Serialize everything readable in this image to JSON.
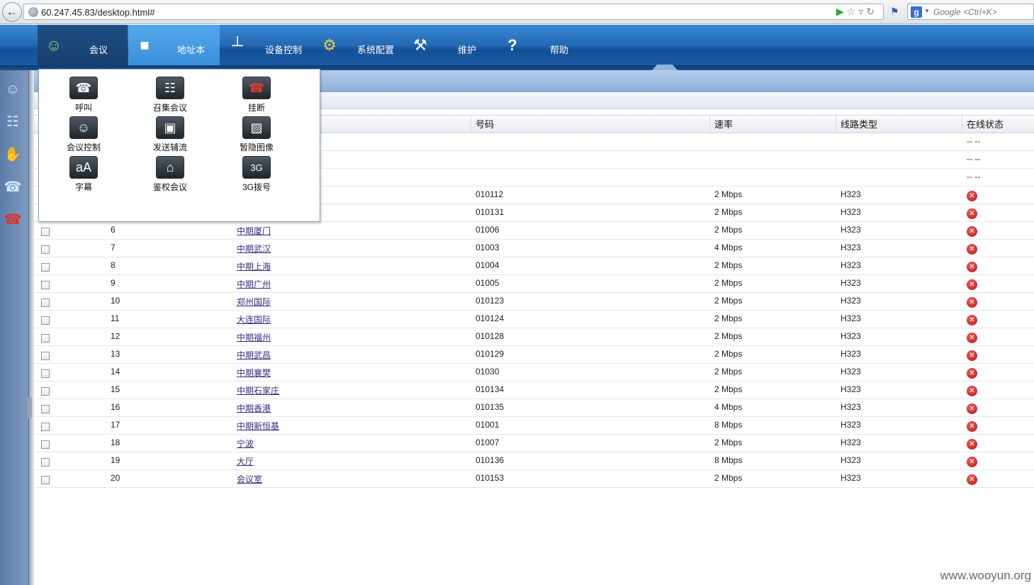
{
  "browser": {
    "back_icon": "arrow-left-icon",
    "url": "60.247.45.83/desktop.html#",
    "search_placeholder": "Google <Ctrl+K>"
  },
  "nav": {
    "tabs": [
      {
        "label": "会议",
        "icon": "people-icon"
      },
      {
        "label": "地址本",
        "icon": "address-book-icon"
      },
      {
        "label": "设备控制",
        "icon": "joystick-icon"
      },
      {
        "label": "系统配置",
        "icon": "gear-icon"
      },
      {
        "label": "维护",
        "icon": "tools-icon"
      },
      {
        "label": "帮助",
        "icon": "question-icon"
      }
    ]
  },
  "sidebar": {
    "items": [
      "meeting-icon",
      "conference-icon",
      "hand-icon",
      "phone-call-icon",
      "hangup-icon"
    ]
  },
  "dropdown": {
    "items": [
      {
        "label": "呼叫",
        "icon": "phone-call-icon"
      },
      {
        "label": "召集会议",
        "icon": "convene-icon"
      },
      {
        "label": "挂断",
        "icon": "hangup-icon"
      },
      {
        "label": "会议控制",
        "icon": "meeting-control-icon"
      },
      {
        "label": "发送辅流",
        "icon": "monitor-icon"
      },
      {
        "label": "暂隐图像",
        "icon": "hide-image-icon"
      },
      {
        "label": "字幕",
        "icon": "caption-icon"
      },
      {
        "label": "鉴权会议",
        "icon": "lock-icon"
      },
      {
        "label": "3G拨号",
        "icon": "3g-dial-icon"
      }
    ]
  },
  "table": {
    "headers": {
      "number": "号码",
      "rate": "速率",
      "line": "线路类型",
      "status": "在线状态"
    },
    "placeholder_status": "-- --",
    "rows": [
      {
        "idx": "",
        "name": "",
        "number": "",
        "rate": "",
        "line": "",
        "status": "placeholder"
      },
      {
        "idx": "",
        "name": "",
        "number": "",
        "rate": "",
        "line": "",
        "status": "placeholder"
      },
      {
        "idx": "",
        "name": "",
        "number": "",
        "rate": "",
        "line": "",
        "status": "placeholder"
      },
      {
        "idx": "",
        "name": "",
        "number": "010112",
        "rate": "2 Mbps",
        "line": "H323",
        "status": "offline"
      },
      {
        "idx": "",
        "name": "",
        "number": "010131",
        "rate": "2 Mbps",
        "line": "H323",
        "status": "offline"
      },
      {
        "idx": "6",
        "name": "中期厦门",
        "number": "01006",
        "rate": "2 Mbps",
        "line": "H323",
        "status": "offline"
      },
      {
        "idx": "7",
        "name": "中期武汉",
        "number": "01003",
        "rate": "4 Mbps",
        "line": "H323",
        "status": "offline"
      },
      {
        "idx": "8",
        "name": "中期上海",
        "number": "01004",
        "rate": "2 Mbps",
        "line": "H323",
        "status": "offline"
      },
      {
        "idx": "9",
        "name": "中期广州",
        "number": "01005",
        "rate": "2 Mbps",
        "line": "H323",
        "status": "offline"
      },
      {
        "idx": "10",
        "name": "郑州国际",
        "number": "010123",
        "rate": "2 Mbps",
        "line": "H323",
        "status": "offline"
      },
      {
        "idx": "11",
        "name": "大连国际",
        "number": "010124",
        "rate": "2 Mbps",
        "line": "H323",
        "status": "offline"
      },
      {
        "idx": "12",
        "name": "中期福州",
        "number": "010128",
        "rate": "2 Mbps",
        "line": "H323",
        "status": "offline"
      },
      {
        "idx": "13",
        "name": "中期武昌",
        "number": "010129",
        "rate": "2 Mbps",
        "line": "H323",
        "status": "offline"
      },
      {
        "idx": "14",
        "name": "中期襄樊",
        "number": "01030",
        "rate": "2 Mbps",
        "line": "H323",
        "status": "offline"
      },
      {
        "idx": "15",
        "name": "中期石家庄",
        "number": "010134",
        "rate": "2 Mbps",
        "line": "H323",
        "status": "offline"
      },
      {
        "idx": "16",
        "name": "中期香港",
        "number": "010135",
        "rate": "4 Mbps",
        "line": "H323",
        "status": "offline"
      },
      {
        "idx": "17",
        "name": "中期新恒基",
        "number": "01001",
        "rate": "8 Mbps",
        "line": "H323",
        "status": "offline"
      },
      {
        "idx": "18",
        "name": "宁波",
        "number": "01007",
        "rate": "2 Mbps",
        "line": "H323",
        "status": "offline"
      },
      {
        "idx": "19",
        "name": "大厅",
        "number": "010136",
        "rate": "8 Mbps",
        "line": "H323",
        "status": "offline"
      },
      {
        "idx": "20",
        "name": "会议室",
        "number": "010153",
        "rate": "2 Mbps",
        "line": "H323",
        "status": "offline"
      }
    ]
  },
  "watermark": "www.wooyun.org",
  "colors": {
    "nav_blue": "#2369b3",
    "offline_red": "#c8211c",
    "link_purple": "#3c2a88"
  }
}
